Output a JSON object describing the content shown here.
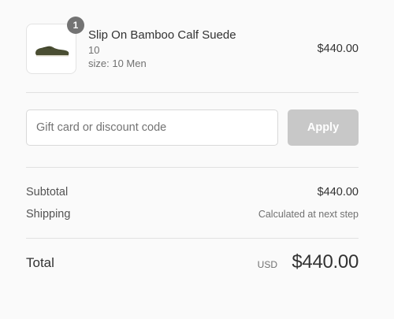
{
  "product": {
    "quantity": "1",
    "name": "Slip On Bamboo Calf Suede",
    "variant": "10",
    "size": "size: 10 Men",
    "price": "$440.00"
  },
  "discount": {
    "placeholder": "Gift card or discount code",
    "apply_label": "Apply"
  },
  "summary": {
    "subtotal_label": "Subtotal",
    "subtotal_value": "$440.00",
    "shipping_label": "Shipping",
    "shipping_value": "Calculated at next step",
    "total_label": "Total",
    "currency": "USD",
    "total_value": "$440.00"
  },
  "colors": {
    "badge": "#737373",
    "apply_disabled": "#c8c8c8",
    "shoe": "#4a4e33"
  }
}
